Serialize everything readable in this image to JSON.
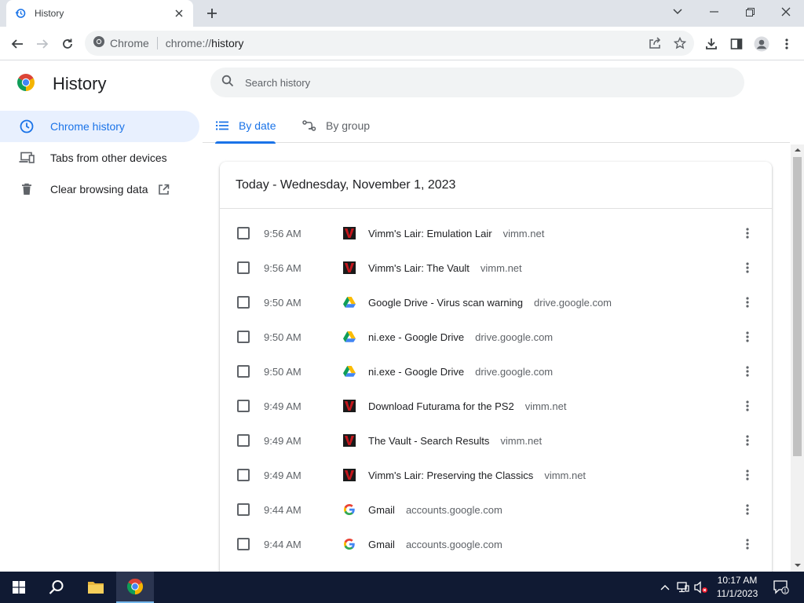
{
  "browser": {
    "tab": {
      "title": "History"
    },
    "omnibox": {
      "site_chip": "Chrome",
      "url_scheme": "chrome://",
      "url_host": "history"
    }
  },
  "page": {
    "title": "History",
    "search_placeholder": "Search history",
    "sidebar": {
      "items": [
        {
          "label": "Chrome history",
          "icon": "clock-icon",
          "active": true
        },
        {
          "label": "Tabs from other devices",
          "icon": "devices-icon",
          "active": false
        },
        {
          "label": "Clear browsing data",
          "icon": "trash-icon",
          "active": false
        }
      ]
    },
    "tabs": [
      {
        "label": "By date",
        "icon": "list-icon",
        "active": true
      },
      {
        "label": "By group",
        "icon": "group-icon",
        "active": false
      }
    ],
    "day_heading": "Today - Wednesday, November 1, 2023",
    "entries": [
      {
        "time": "9:56 AM",
        "title": "Vimm's Lair: Emulation Lair",
        "domain": "vimm.net",
        "favicon": "vimm-icon"
      },
      {
        "time": "9:56 AM",
        "title": "Vimm's Lair: The Vault",
        "domain": "vimm.net",
        "favicon": "vimm-icon"
      },
      {
        "time": "9:50 AM",
        "title": "Google Drive - Virus scan warning",
        "domain": "drive.google.com",
        "favicon": "google-drive-icon"
      },
      {
        "time": "9:50 AM",
        "title": "ni.exe - Google Drive",
        "domain": "drive.google.com",
        "favicon": "google-drive-icon"
      },
      {
        "time": "9:50 AM",
        "title": "ni.exe - Google Drive",
        "domain": "drive.google.com",
        "favicon": "google-drive-icon"
      },
      {
        "time": "9:49 AM",
        "title": "Download Futurama for the PS2",
        "domain": "vimm.net",
        "favicon": "vimm-icon"
      },
      {
        "time": "9:49 AM",
        "title": "The Vault - Search Results",
        "domain": "vimm.net",
        "favicon": "vimm-icon"
      },
      {
        "time": "9:49 AM",
        "title": "Vimm's Lair: Preserving the Classics",
        "domain": "vimm.net",
        "favicon": "vimm-icon"
      },
      {
        "time": "9:44 AM",
        "title": "Gmail",
        "domain": "accounts.google.com",
        "favicon": "google-icon"
      },
      {
        "time": "9:44 AM",
        "title": "Gmail",
        "domain": "accounts.google.com",
        "favicon": "google-icon"
      }
    ]
  },
  "taskbar": {
    "clock_time": "10:17 AM",
    "clock_date": "11/1/2023",
    "notification_count": "1"
  },
  "colors": {
    "accent": "#1a73e8",
    "vimm_red": "#c4161c",
    "taskbar": "#101a33"
  }
}
